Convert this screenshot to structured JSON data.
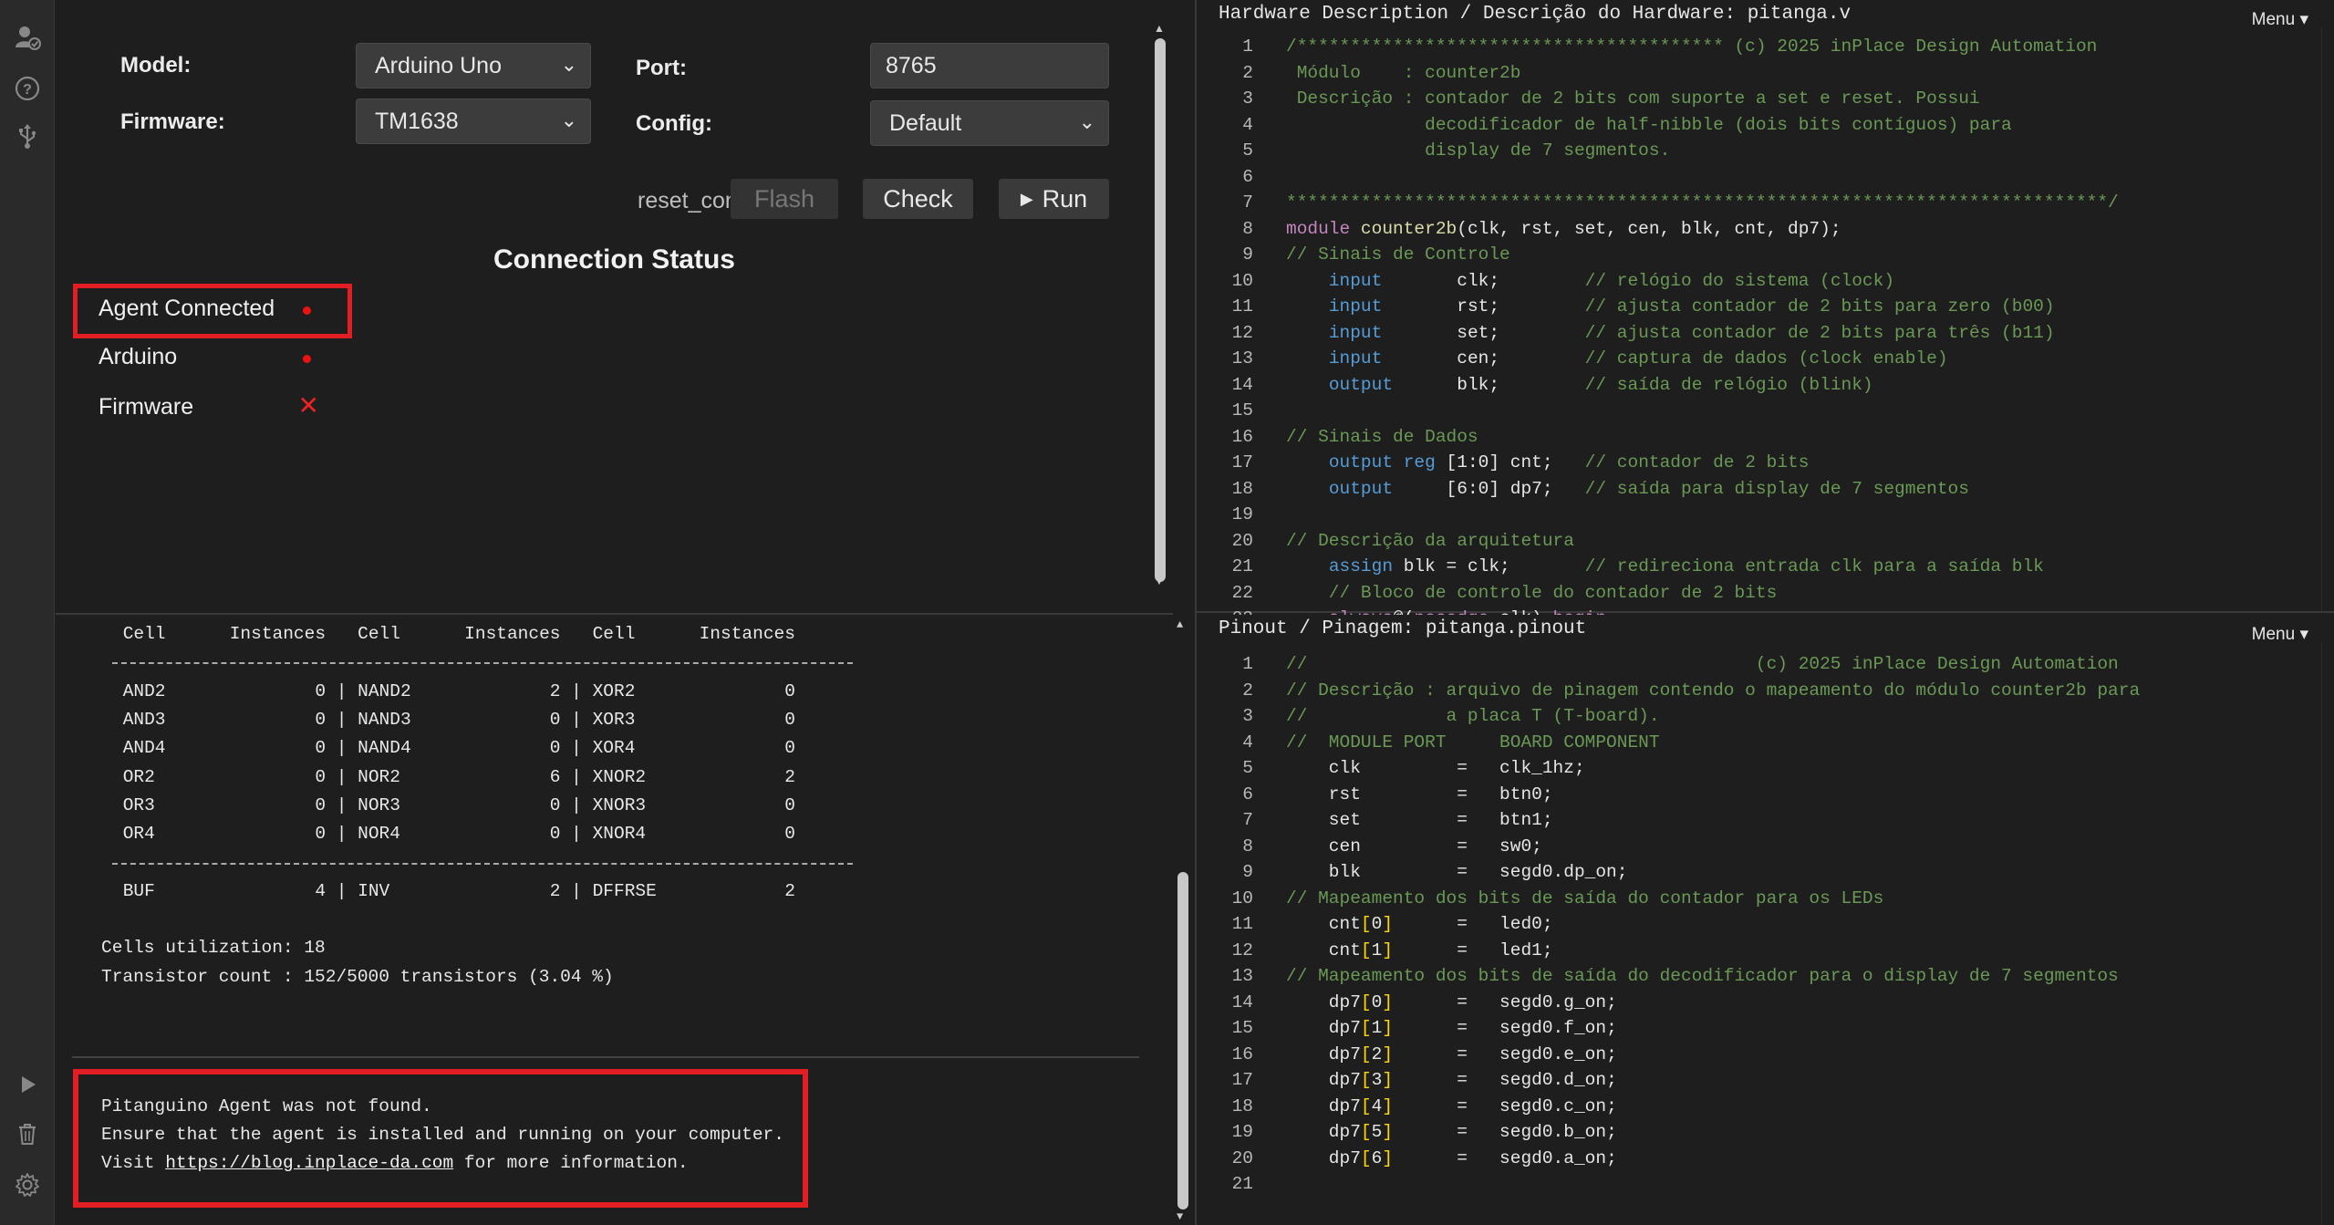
{
  "activity_bar": {
    "top_icons": [
      "user-check-icon",
      "help-circle-icon",
      "usb-icon"
    ],
    "bottom_icons": [
      "play-icon",
      "trash-icon",
      "settings-icon"
    ]
  },
  "config": {
    "model_label": "Model:",
    "model_value": "Arduino Uno",
    "firmware_label": "Firmware:",
    "firmware_value": "TM1638",
    "port_label": "Port:",
    "port_value": "8765",
    "config_label": "Config:",
    "config_value": "Default",
    "reset_config": "reset_config",
    "flash_label": "Flash",
    "check_label": "Check",
    "run_label": "Run",
    "connection_title": "Connection Status",
    "status": [
      {
        "label": "Agent Connected",
        "state": "dot"
      },
      {
        "label": "Arduino",
        "state": "dot"
      },
      {
        "label": "Firmware",
        "state": "x"
      }
    ],
    "status_red": "#e01e24"
  },
  "report": {
    "header": " Cell      Instances   Cell      Instances   Cell      Instances",
    "rows": [
      " AND2              0 | NAND2             2 | XOR2              0",
      " AND3              0 | NAND3             0 | XOR3              0",
      " AND4              0 | NAND4             0 | XOR4              0",
      " OR2               0 | NOR2              6 | XNOR2             2",
      " OR3               0 | NOR3              0 | XNOR3             0",
      " OR4               0 | NOR4              0 | XNOR4             0"
    ],
    "footer_row": " BUF               4 | INV               2 | DFFRSE            2",
    "cells_util": "Cells utilization: 18",
    "transistor": "Transistor count : 152/5000 transistors (3.04 %)",
    "msg1": "Pitanguino Agent was not found.",
    "msg2": "Ensure that the agent is installed and running on your computer.",
    "msg3_pre": "Visit ",
    "msg3_link": "https://blog.inplace-da.com",
    "msg3_post": " for more information."
  },
  "editor_top": {
    "title": "Hardware Description / Descrição do Hardware: pitanga.v",
    "menu": "Menu"
  },
  "editor_bottom": {
    "title": "Pinout / Pinagem: pitanga.pinout",
    "menu": "Menu"
  },
  "colors": {
    "comment": "#6a9955",
    "keyword": "#569cd6",
    "control": "#c586c0",
    "function": "#dcdcaa",
    "bracket": "#ffd700",
    "highlight_border": "#e01e24"
  }
}
